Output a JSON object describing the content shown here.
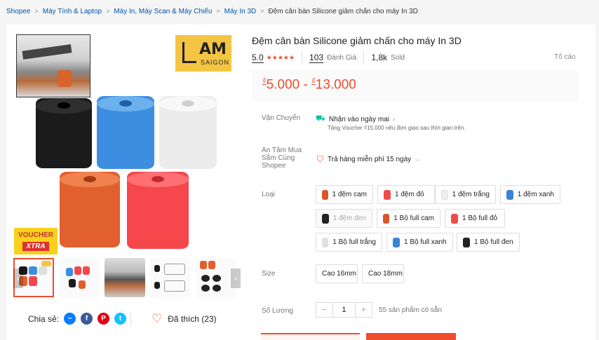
{
  "breadcrumb": {
    "items": [
      "Shopee",
      "Máy Tính & Laptop",
      "Máy In, Máy Scan & Máy Chiếu",
      "Máy In 3D"
    ],
    "current": "Đệm cân bàn Silicone giảm chấn cho máy In 3D"
  },
  "gallery": {
    "logo_text": "AM",
    "logo_sub": "SAIGON",
    "voucher_line1": "VOUCHER",
    "voucher_line2": "XTRA",
    "prev_icon": "chevron-left-icon",
    "next_icon": "chevron-right-icon"
  },
  "share": {
    "label": "Chia sẻ:",
    "icons": [
      "messenger-icon",
      "facebook-icon",
      "pinterest-icon",
      "twitter-icon"
    ]
  },
  "like": {
    "label": "Đã thích (23)"
  },
  "product": {
    "title": "Đệm cân bàn Silicone giảm chấn cho máy In 3D",
    "rating": "5.0",
    "stars": "★★★★★",
    "reviews_count": "103",
    "reviews_label": "Đánh Giá",
    "sold_count": "1,8k",
    "sold_label": "Sold",
    "report": "Tố cáo",
    "currency": "₫",
    "price_low": "5.000",
    "price_sep": " - ",
    "price_high": "13.000"
  },
  "shipping": {
    "label": "Vận Chuyển",
    "main": "Nhận vào ngày mai",
    "sub": "Tặng Voucher ₫15.000 nếu đơn giao sau thời gian trên."
  },
  "assurance": {
    "label": "An Tâm Mua Sắm Cùng Shopee",
    "value": "Trả hàng miễn phí 15 ngày"
  },
  "variants": {
    "label": "Loại",
    "options": [
      {
        "label": "1 đệm cam",
        "color": "#d9552a"
      },
      {
        "label": "1 đệm đỏ",
        "color": "#ef4b4b"
      },
      {
        "label": "1 đệm trắng",
        "color": "#eeeeee"
      },
      {
        "label": "1 đệm xanh",
        "color": "#3a84d6"
      },
      {
        "label": "1 đệm đen",
        "color": "#222222"
      },
      {
        "label": "1 Bộ full cam",
        "color": "#d9552a"
      },
      {
        "label": "1 Bộ full đỏ",
        "color": "#ef4b4b"
      },
      {
        "label": "1 Bộ full trắng",
        "color": "#e0e0e0"
      },
      {
        "label": "1 Bộ full xanh",
        "color": "#3a84d6"
      },
      {
        "label": "1 Bộ full đen",
        "color": "#222222"
      }
    ]
  },
  "size": {
    "label": "Size",
    "options": [
      "Cao 16mm",
      "Cao 18mm"
    ]
  },
  "quantity": {
    "label": "Số Lượng",
    "minus": "−",
    "value": "1",
    "plus": "+",
    "stock": "55 sản phẩm có sẵn"
  },
  "colors": {
    "accent": "#ee4d2d",
    "link": "#0055aa"
  }
}
